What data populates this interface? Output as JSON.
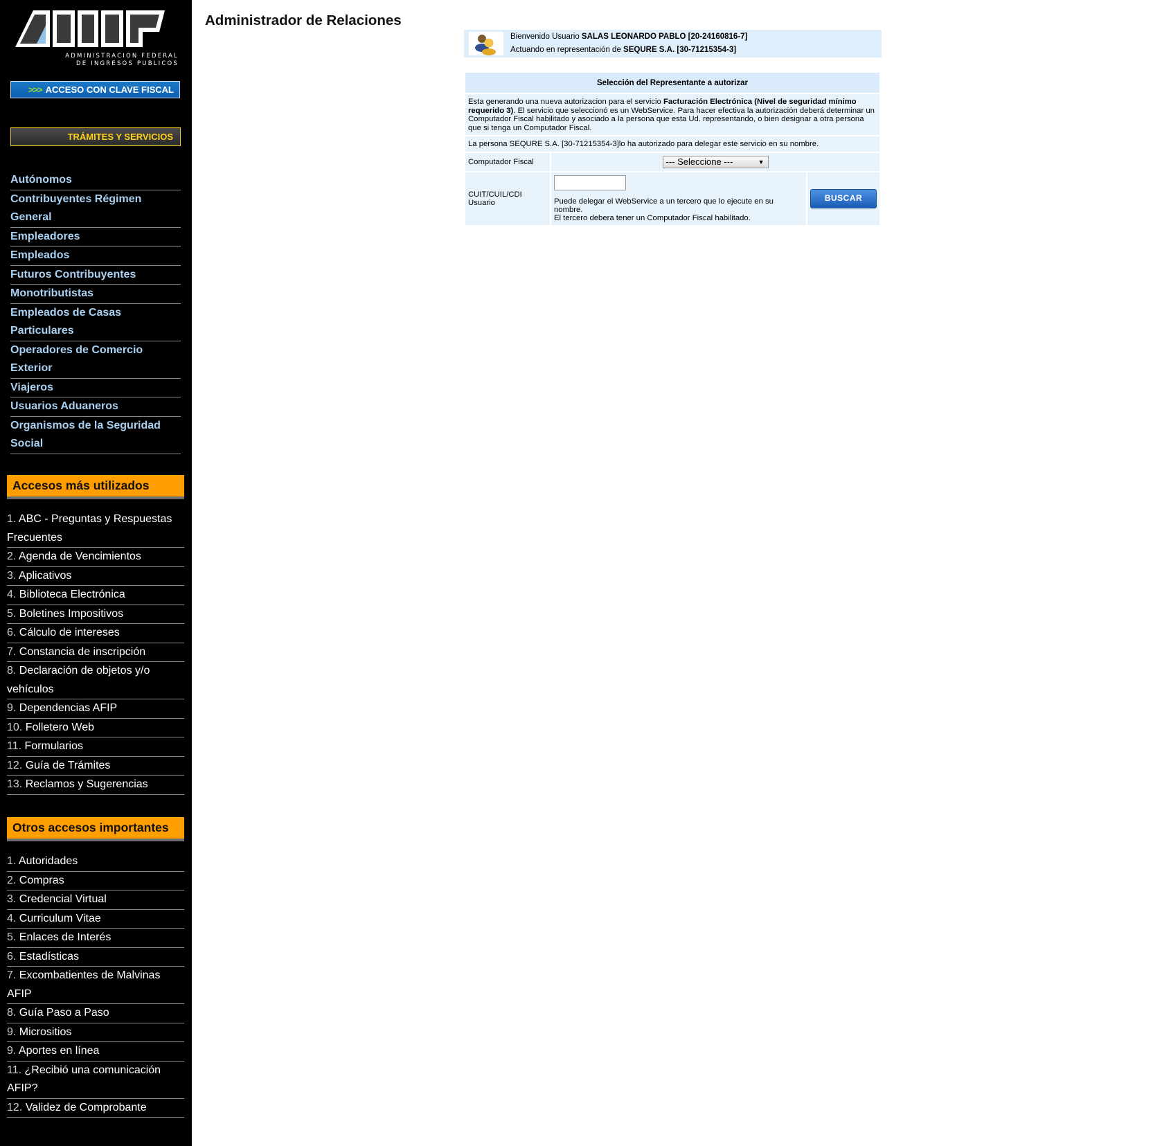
{
  "logo": {
    "line1": "ADMINISTRACION FEDERAL",
    "line2": "DE INGRESOS PUBLICOS"
  },
  "sidebar": {
    "clave_fiscal_arrows": ">>>",
    "clave_fiscal_label": "ACCESO CON CLAVE FISCAL",
    "tramites_label": "TRÁMITES Y SERVICIOS",
    "nav": [
      "Autónomos",
      "Contribuyentes Régimen General",
      "Empleadores",
      "Empleados",
      "Futuros Contribuyentes",
      "Monotributistas",
      "Empleados de Casas Particulares",
      "Operadores de Comercio Exterior",
      "Viajeros",
      "Usuarios Aduaneros",
      "Organismos de la Seguridad Social"
    ],
    "accesos_title": "Accesos más utilizados",
    "accesos": [
      {
        "num": "1.",
        "label": "ABC - Preguntas y Respuestas Frecuentes"
      },
      {
        "num": "2.",
        "label": "Agenda de Vencimientos"
      },
      {
        "num": "3.",
        "label": "Aplicativos"
      },
      {
        "num": "4.",
        "label": "Biblioteca Electrónica"
      },
      {
        "num": "5.",
        "label": "Boletines Impositivos"
      },
      {
        "num": "6.",
        "label": "Cálculo de intereses"
      },
      {
        "num": "7.",
        "label": "Constancia de inscripción"
      },
      {
        "num": "8.",
        "label": "Declaración de objetos y/o vehículos"
      },
      {
        "num": "9.",
        "label": "Dependencias AFIP"
      },
      {
        "num": "10.",
        "label": "Folletero Web"
      },
      {
        "num": "11.",
        "label": "Formularios"
      },
      {
        "num": "12.",
        "label": "Guía de Trámites"
      },
      {
        "num": "13.",
        "label": "Reclamos y Sugerencias"
      }
    ],
    "otros_title": "Otros accesos importantes",
    "otros": [
      {
        "num": "1.",
        "label": "Autoridades"
      },
      {
        "num": "2.",
        "label": "Compras"
      },
      {
        "num": "3.",
        "label": "Credencial Virtual"
      },
      {
        "num": "4.",
        "label": "Curriculum Vitae"
      },
      {
        "num": "5.",
        "label": "Enlaces de Interés"
      },
      {
        "num": "6.",
        "label": "Estadísticas"
      },
      {
        "num": "7.",
        "label": "Excombatientes de Malvinas AFIP"
      },
      {
        "num": "8.",
        "label": "Guía Paso a Paso"
      },
      {
        "num": "9.",
        "label": "Micrositios"
      },
      {
        "num": "9.",
        "label": "Aportes en línea"
      },
      {
        "num": "11.",
        "label": "¿Recibió una comunicación AFIP?"
      },
      {
        "num": "12.",
        "label": "Validez de Comprobante"
      }
    ]
  },
  "main": {
    "title": "Administrador de Relaciones",
    "user": {
      "welcome_prefix": "Bienvenido Usuario ",
      "user_name": "SALAS LEONARDO PABLO [20-24160816-7]",
      "acting_prefix": "Actuando en representación de ",
      "company": "SEQURE S.A. [30-71215354-3]"
    },
    "panel": {
      "header": "Selección del Representante a autorizar",
      "desc_prefix": "Esta generando una nueva autorizacion para el servicio ",
      "desc_service": "Facturación Electrónica (Nivel de seguridad mínimo requerido 3)",
      "desc_suffix": ". El servicio que seleccionó es un WebService. Para hacer efectiva la autorización deberá determinar un Computador Fiscal habilitado y asociado a la persona que esta Ud. representando, o bien designar a otra persona que si tenga un Computador Fiscal.",
      "delegation_text": "La persona SEQURE S.A. [30-71215354-3]lo ha autorizado para delegar este servicio en su nombre.",
      "computador_label": "Computador Fiscal",
      "computador_selected": "--- Seleccione ---",
      "cuit_label_line1": "CUIT/CUIL/CDI",
      "cuit_label_line2": "Usuario",
      "cuit_value": "",
      "hint_line1": "Puede delegar el WebService a un tercero que lo ejecute en su nombre.",
      "hint_line2": "El tercero debera tener un Computador Fiscal habilitado.",
      "buscar_label": "BUSCAR"
    }
  }
}
